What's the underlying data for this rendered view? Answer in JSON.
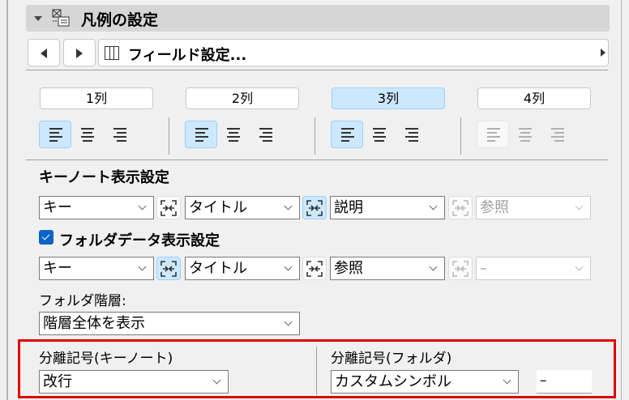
{
  "panel": {
    "title": "凡例の設定",
    "icon": "legend-icon"
  },
  "nav": {
    "prev_icon": "triangle-left-icon",
    "next_icon": "triangle-right-icon",
    "field_label": "フィールド設定...",
    "field_icon": "columns-icon"
  },
  "columns": [
    {
      "label": "1列",
      "selected": false,
      "align": "left",
      "disabled": false
    },
    {
      "label": "2列",
      "selected": false,
      "align": "left",
      "disabled": false
    },
    {
      "label": "3列",
      "selected": true,
      "align": "left",
      "disabled": false
    },
    {
      "label": "4列",
      "selected": false,
      "align": "none",
      "disabled": true
    }
  ],
  "keynote": {
    "heading": "キーノート表示設定",
    "fields": [
      "キー",
      "タイトル",
      "説明",
      "参照"
    ]
  },
  "folder": {
    "checkbox_label": "フォルダデータ表示設定",
    "checked": true,
    "fields": [
      "キー",
      "タイトル",
      "参照",
      "–"
    ],
    "hierarchy_label": "フォルダ階層:",
    "hierarchy_value": "階層全体を表示"
  },
  "separators": {
    "keynote_label": "分離記号(キーノート)",
    "keynote_value": "改行",
    "folder_label": "分離記号(フォルダ)",
    "folder_value": "カスタムシンボル",
    "custom_symbol": "–"
  },
  "colors": {
    "highlight": "#e00000",
    "selected": "#cce8ff",
    "checkbox": "#0a64c8"
  }
}
